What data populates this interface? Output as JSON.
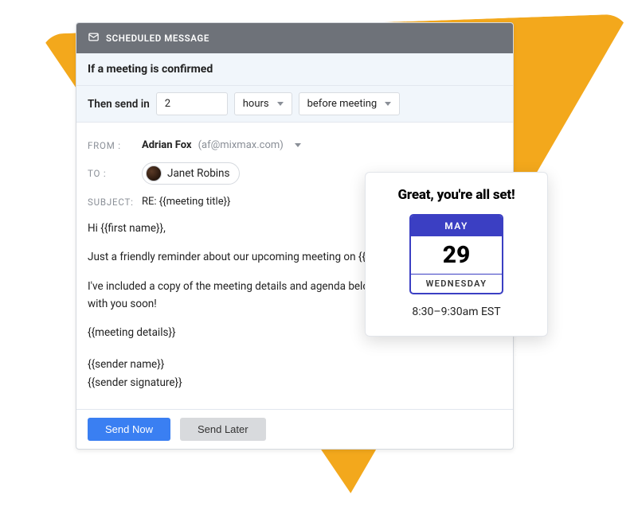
{
  "header": {
    "title": "SCHEDULED MESSAGE"
  },
  "condition": {
    "text": "If a meeting is confirmed"
  },
  "send": {
    "label": "Then send in",
    "value": "2",
    "unit": "hours",
    "relative": "before meeting"
  },
  "from": {
    "label": "FROM :",
    "name": "Adrian Fox",
    "email": "(af@mixmax.com)"
  },
  "to": {
    "label": "TO :",
    "recipient": "Janet Robins"
  },
  "subject": {
    "label": "SUBJECT:",
    "value": "RE: {{meeting title}}"
  },
  "body": {
    "greeting": "Hi {{first name}},",
    "p1": "Just a friendly reminder about our upcoming meeting on {{meeting time}}.",
    "p2": "I've included a copy of the meeting details and agenda below. I look forward to talking with you soon!",
    "details": "{{meeting details}}",
    "sig1": "{{sender name}}",
    "sig2": "{{sender signature}}"
  },
  "buttons": {
    "send_now": "Send Now",
    "send_later": "Send Later"
  },
  "popup": {
    "title": "Great, you're all set!",
    "month": "MAY",
    "day": "29",
    "weekday": "WEDNESDAY",
    "time": "8:30–9:30am EST"
  }
}
